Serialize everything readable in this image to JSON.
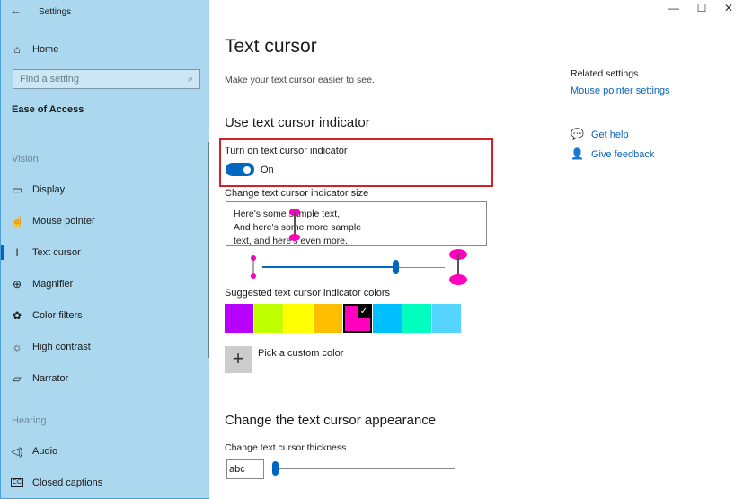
{
  "window": {
    "title": "Settings",
    "minimize": "—",
    "maximize": "☐",
    "close": "✕"
  },
  "sidebar": {
    "home": "Home",
    "search_placeholder": "Find a setting",
    "category": "Ease of Access",
    "sections": [
      {
        "title": "Vision",
        "items": [
          {
            "label": "Display",
            "icon": "monitor-icon"
          },
          {
            "label": "Mouse pointer",
            "icon": "mouse-pointer-icon"
          },
          {
            "label": "Text cursor",
            "icon": "text-cursor-icon",
            "selected": true
          },
          {
            "label": "Magnifier",
            "icon": "magnifier-icon"
          },
          {
            "label": "Color filters",
            "icon": "palette-icon"
          },
          {
            "label": "High contrast",
            "icon": "sun-icon"
          },
          {
            "label": "Narrator",
            "icon": "narrator-icon"
          }
        ]
      },
      {
        "title": "Hearing",
        "items": [
          {
            "label": "Audio",
            "icon": "speaker-icon"
          },
          {
            "label": "Closed captions",
            "icon": "cc-icon"
          }
        ]
      }
    ]
  },
  "main": {
    "title": "Text cursor",
    "subtitle": "Make your text cursor easier to see.",
    "indicator_heading": "Use text cursor indicator",
    "toggle_label": "Turn on text cursor indicator",
    "toggle_state": "On",
    "size_label": "Change text cursor indicator size",
    "sample_lines": [
      "Here's some sample text,",
      "And here's some more sample",
      "text, and here's even more."
    ],
    "size_slider_percent": 74,
    "colors_label": "Suggested text cursor indicator colors",
    "colors": [
      "#b800ff",
      "#bfff00",
      "#ffff00",
      "#ffbf00",
      "#ff00bf",
      "#00bfff",
      "#00ffbf",
      "#55d4ff"
    ],
    "selected_color": "#ff00bf",
    "custom_color": "Pick a custom color",
    "appearance_heading": "Change the text cursor appearance",
    "thickness_label": "Change text cursor thickness",
    "thickness_preview": "abc",
    "thickness_slider_percent": 0,
    "accent": "#0067c0",
    "highlight_box_color": "#d0202a"
  },
  "related": {
    "heading": "Related settings",
    "link": "Mouse pointer settings",
    "help": "Get help",
    "feedback": "Give feedback"
  }
}
